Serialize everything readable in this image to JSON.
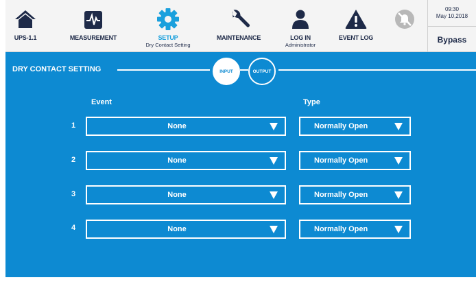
{
  "nav": {
    "ups": {
      "label": "UPS-1.1",
      "icon": "home-icon"
    },
    "measurement": {
      "label": "MEASUREMENT",
      "icon": "waveform-icon"
    },
    "setup": {
      "label": "SETUP",
      "sub": "Dry Contact Setting",
      "icon": "gear-icon"
    },
    "maintenance": {
      "label": "MAINTENANCE",
      "icon": "wrench-icon"
    },
    "login": {
      "label": "LOG IN",
      "sub": "Administrator",
      "icon": "user-icon"
    },
    "eventlog": {
      "label": "EVENT LOG",
      "icon": "warning-icon"
    },
    "mute": {
      "icon": "buzzer-muted-icon"
    }
  },
  "status": {
    "time": "09:30",
    "date": "May 10,2018",
    "mode": "Bypass"
  },
  "section": {
    "title": "DRY CONTACT SETTING",
    "input_label": "INPUT",
    "output_label": "OUTPUT",
    "selected_tab": "INPUT"
  },
  "table": {
    "event_header": "Event",
    "type_header": "Type",
    "rows": [
      {
        "num": "1",
        "event": "None",
        "type": "Normally Open"
      },
      {
        "num": "2",
        "event": "None",
        "type": "Normally Open"
      },
      {
        "num": "3",
        "event": "None",
        "type": "Normally Open"
      },
      {
        "num": "4",
        "event": "None",
        "type": "Normally Open"
      }
    ]
  },
  "colors": {
    "panel_blue": "#0d8ad2",
    "nav_dark": "#1e2a48",
    "accent_blue": "#1aa0dd",
    "muted_gray": "#b8b8b8"
  }
}
